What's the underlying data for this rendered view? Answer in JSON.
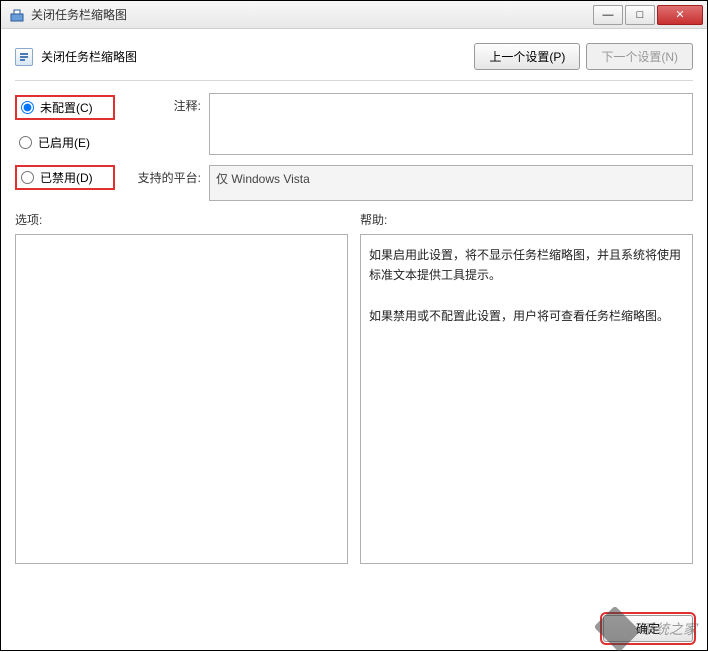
{
  "window": {
    "title": "关闭任务栏缩略图",
    "min_glyph": "—",
    "max_glyph": "□",
    "close_glyph": "✕"
  },
  "header": {
    "title": "关闭任务栏缩略图",
    "prev_label": "上一个设置(P)",
    "next_label": "下一个设置(N)"
  },
  "radios": {
    "not_configured": "未配置(C)",
    "enabled": "已启用(E)",
    "disabled": "已禁用(D)",
    "selected": "not_configured"
  },
  "fields": {
    "comment_label": "注释:",
    "comment_value": "",
    "platform_label": "支持的平台:",
    "platform_value": "仅 Windows Vista"
  },
  "lower": {
    "options_label": "选项:",
    "help_label": "帮助:",
    "help_text_1": "如果启用此设置，将不显示任务栏缩略图，并且系统将使用标准文本提供工具提示。",
    "help_text_2": "如果禁用或不配置此设置，用户将可查看任务栏缩略图。"
  },
  "footer": {
    "ok_label": "确定"
  },
  "watermark": {
    "text": "系统之家"
  }
}
